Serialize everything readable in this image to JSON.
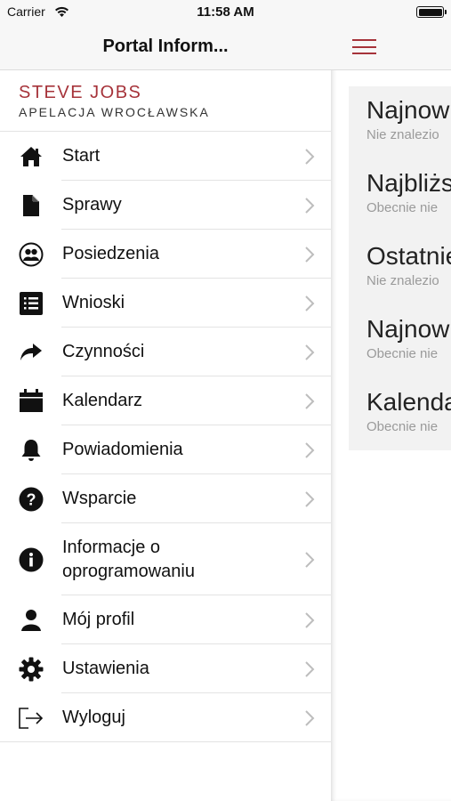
{
  "status_bar": {
    "carrier": "Carrier",
    "time": "11:58 AM"
  },
  "side_menu": {
    "title": "Portal Inform...",
    "user_name": "STEVE JOBS",
    "court": "APELACJA WROCŁAWSKA",
    "items": [
      {
        "label": "Start",
        "icon": "home-icon"
      },
      {
        "label": "Sprawy",
        "icon": "document-icon"
      },
      {
        "label": "Posiedzenia",
        "icon": "people-icon"
      },
      {
        "label": "Wnioski",
        "icon": "list-icon"
      },
      {
        "label": "Czynności",
        "icon": "share-arrow-icon"
      },
      {
        "label": "Kalendarz",
        "icon": "calendar-icon"
      },
      {
        "label": "Powiadomienia",
        "icon": "bell-icon"
      },
      {
        "label": "Wsparcie",
        "icon": "help-icon"
      },
      {
        "label": "Informacje o oprogramowaniu",
        "line1": "Informacje o",
        "line2": "oprogramowaniu",
        "icon": "info-icon"
      },
      {
        "label": "Mój profil",
        "icon": "user-icon"
      },
      {
        "label": "Ustawienia",
        "icon": "gear-icon"
      },
      {
        "label": "Wyloguj",
        "icon": "logout-icon"
      }
    ]
  },
  "main": {
    "cards": [
      {
        "title": "Najnow",
        "subtitle": "Nie znalezio"
      },
      {
        "title": "Najbliżs",
        "subtitle": "Obecnie nie"
      },
      {
        "title": "Ostatnie",
        "subtitle": "Nie znalezio"
      },
      {
        "title": "Najnow",
        "subtitle": "Obecnie nie"
      },
      {
        "title": "Kalenda",
        "subtitle": "Obecnie nie"
      }
    ]
  },
  "colors": {
    "accent": "#a6333a",
    "header_bg": "#f7f7f7",
    "card_bg": "#f2f2f2"
  }
}
